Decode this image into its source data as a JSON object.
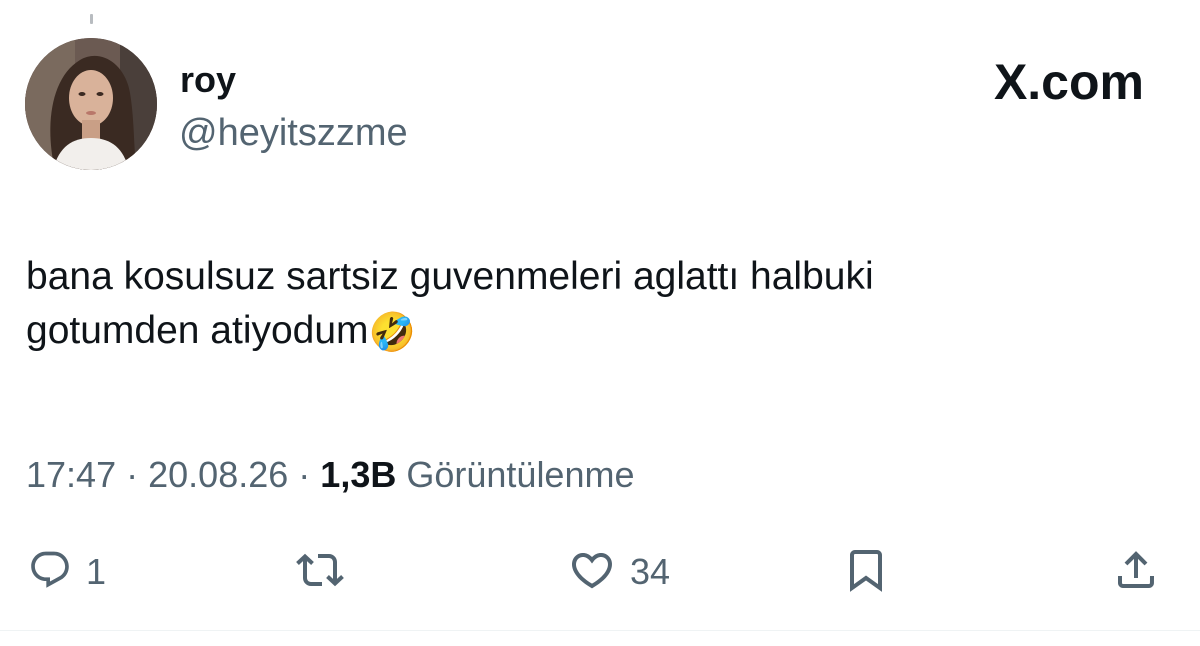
{
  "user": {
    "display_name": "roy",
    "handle": "@heyitszzme"
  },
  "brand": {
    "logo_text": "X.com"
  },
  "tweet": {
    "text_line1": "bana kosulsuz sartsiz guvenmeleri aglattı halbuki",
    "text_line2": "gotumden atiyodum",
    "emoji": "🤣",
    "emoji_name": "rolling-on-the-floor-laughing-emoji"
  },
  "meta": {
    "time": "17:47",
    "separator": "·",
    "date": "20.08.26",
    "views_count": "1,3B",
    "views_label": "Görüntülenme"
  },
  "actions": {
    "reply_count": "1",
    "like_count": "34",
    "icons": [
      "reply-icon",
      "retweet-icon",
      "like-icon",
      "bookmark-icon",
      "share-icon"
    ]
  },
  "colors": {
    "text_primary": "#0f1419",
    "text_secondary": "#536471",
    "divider": "#eff3f4"
  }
}
